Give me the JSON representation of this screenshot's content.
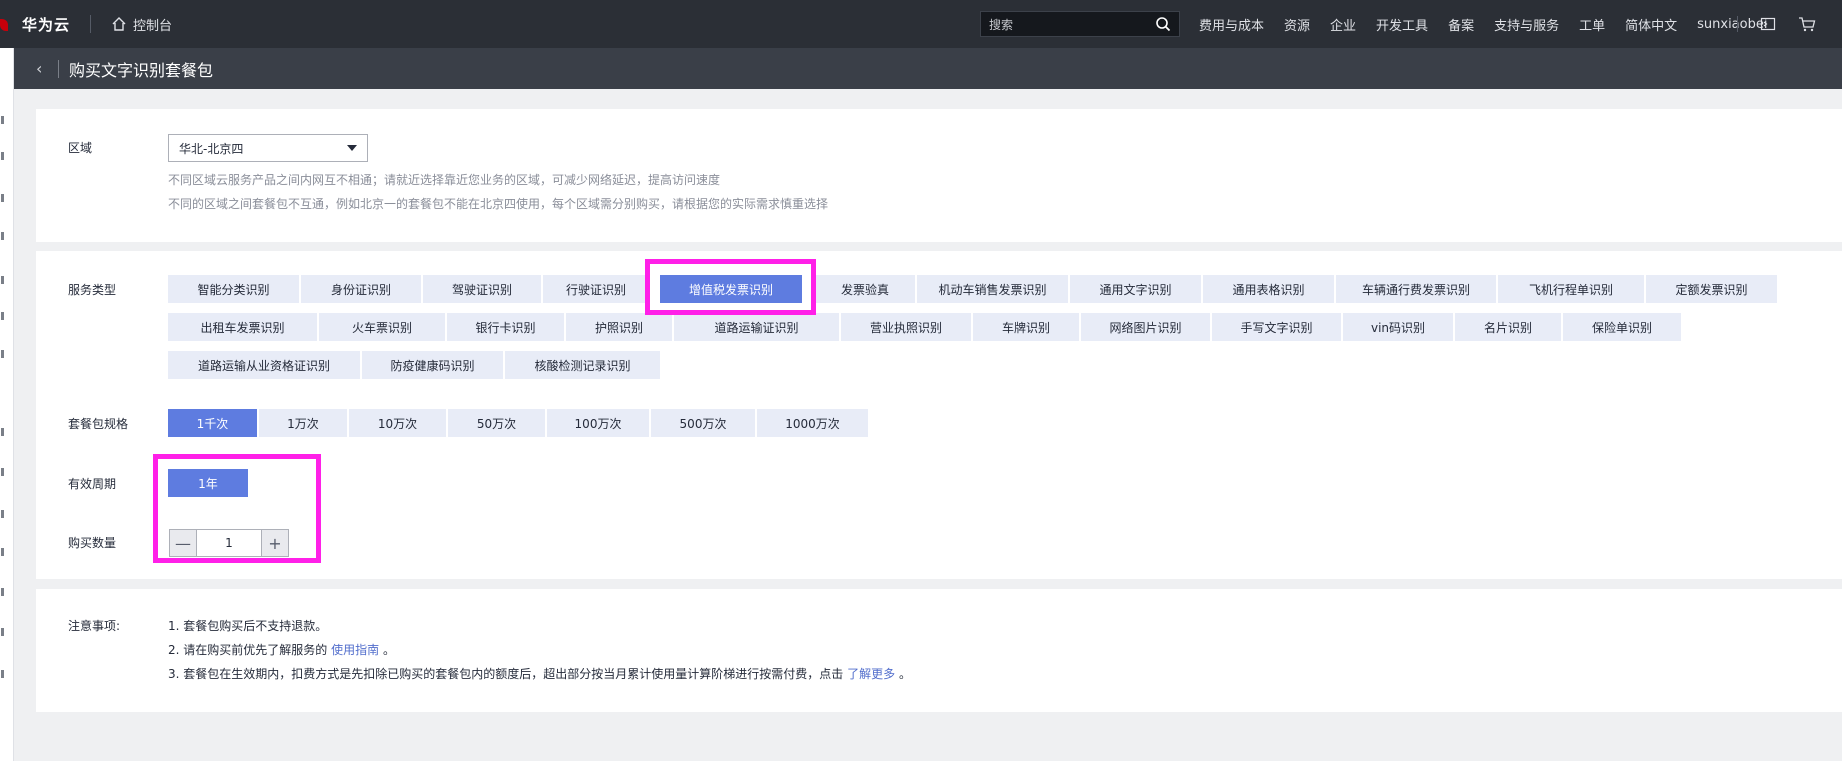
{
  "topbar": {
    "brand": "华为云",
    "console": "控制台",
    "search_placeholder": "搜索",
    "links": [
      "费用与成本",
      "资源",
      "企业",
      "开发工具",
      "备案",
      "支持与服务",
      "工单",
      "简体中文",
      "sunxiaobei"
    ]
  },
  "page": {
    "title": "购买文字识别套餐包"
  },
  "region": {
    "label": "区域",
    "value": "华北-北京四",
    "hint1": "不同区域云服务产品之间内网互不相通；请就近选择靠近您业务的区域，可减少网络延迟，提高访问速度",
    "hint2": "不同的区域之间套餐包不互通，例如北京一的套餐包不能在北京四使用，每个区域需分别购买，请根据您的实际需求慎重选择"
  },
  "service": {
    "label": "服务类型",
    "selected": "增值税发票识别",
    "row1": [
      "智能分类识别",
      "身份证识别",
      "驾驶证识别",
      "行驶证识别",
      "增值税发票识别",
      "发票验真",
      "机动车销售发票识别",
      "通用文字识别",
      "通用表格识别",
      "车辆通行费发票识别",
      "飞机行程单识别",
      "定额发票识别"
    ],
    "row2": [
      "出租车发票识别",
      "火车票识别",
      "银行卡识别",
      "护照识别",
      "道路运输证识别",
      "营业执照识别",
      "车牌识别",
      "网络图片识别",
      "手写文字识别",
      "vin码识别",
      "名片识别",
      "保险单识别"
    ],
    "row3": [
      "道路运输从业资格证识别",
      "防疫健康码识别",
      "核酸检测记录识别"
    ]
  },
  "spec": {
    "label": "套餐包规格",
    "options": [
      "1千次",
      "1万次",
      "10万次",
      "50万次",
      "100万次",
      "500万次",
      "1000万次"
    ],
    "selected": "1千次"
  },
  "period": {
    "label": "有效周期",
    "value": "1年"
  },
  "quantity": {
    "label": "购买数量",
    "minus": "—",
    "value": "1",
    "plus": "+"
  },
  "notes": {
    "label": "注意事项:",
    "n1": "1. 套餐包购买后不支持退款。",
    "n2_pre": "2. 请在购买前优先了解服务的",
    "n2_link": "使用指南",
    "n2_post": "。",
    "n3_pre": "3. 套餐包在生效期内，扣费方式是先扣除已购买的套餐包内的额度后，超出部分按当月累计使用量计算阶梯进行按需付费，点击",
    "n3_link": "了解更多",
    "n3_post": "。"
  },
  "colors": {
    "accent": "#5e7ce0",
    "highlight": "#ff20e8",
    "topbar": "#2b2f36"
  }
}
